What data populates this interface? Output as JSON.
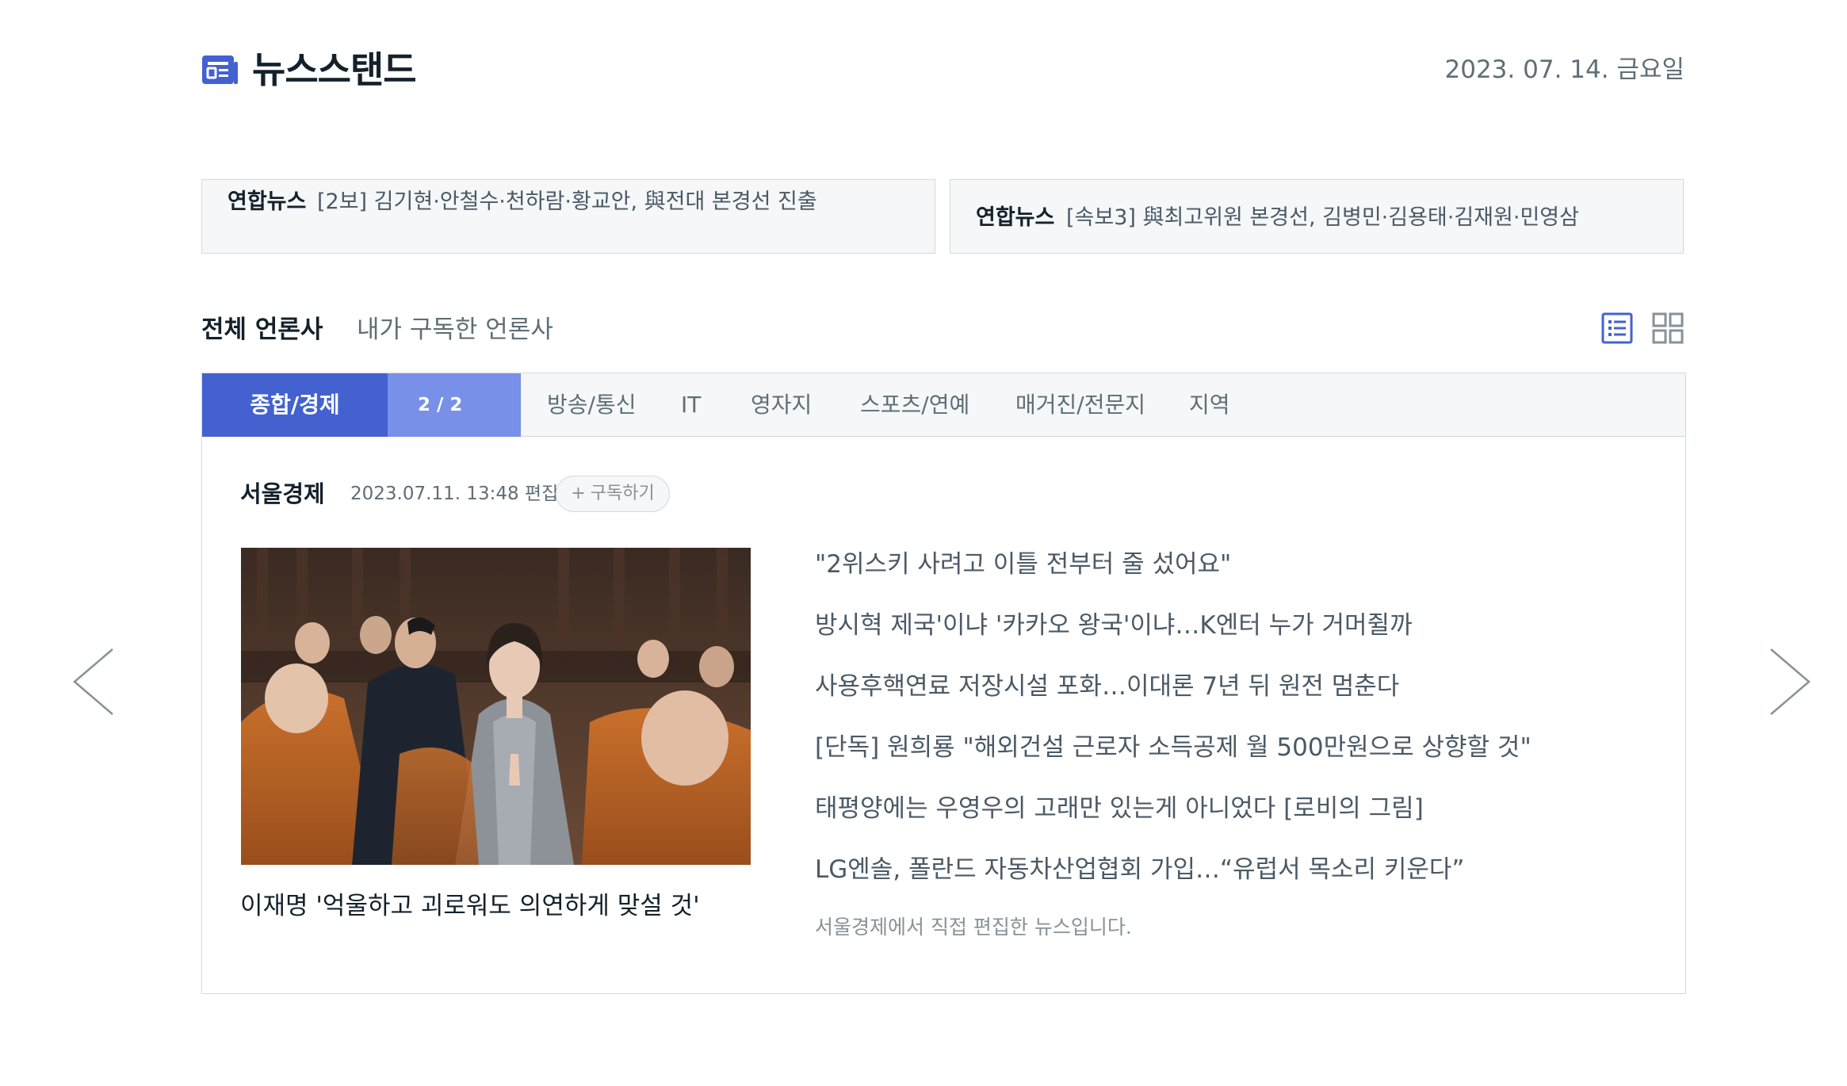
{
  "header": {
    "brand": "뉴스스탠드",
    "date": "2023. 07. 14. 금요일"
  },
  "headlines": [
    {
      "source": "연합뉴스",
      "title": "[2보] 김기현·안철수·천하람·황교안, 與전대 본경선 진출"
    },
    {
      "source": "연합뉴스",
      "title": "[속보3] 與최고위원 본경선, 김병민·김용태·김재원·민영삼"
    }
  ],
  "press_tabs": {
    "all": "전체 언론사",
    "mine": "내가 구독한 언론사"
  },
  "category_tabs": {
    "active": "종합/경제",
    "counter": "2 / 2",
    "items": [
      "방송/통신",
      "IT",
      "영자지",
      "스포츠/연예",
      "매거진/전문지",
      "지역"
    ]
  },
  "press": {
    "name": "서울경제",
    "edited": "2023.07.11. 13:48 편집",
    "subscribe": "구독하기",
    "subscribe_plus": "+"
  },
  "main_article": {
    "title": "이재명 '억울하고 괴로워도 의연하게 맞설 것'"
  },
  "news": [
    "\"2위스키 사려고 이틀 전부터 줄 섰어요\"",
    "방시혁 제국'이냐 '카카오 왕국'이냐…K엔터 누가 거머쥘까",
    "사용후핵연료 저장시설 포화…이대론 7년 뒤 원전 멈춘다",
    "[단독] 원희룡 \"해외건설 근로자 소득공제 월 500만원으로 상향할 것\"",
    "태평양에는 우영우의 고래만 있는게 아니었다 [로비의 그림]",
    "LG엔솔, 폴란드 자동차산업협회 가입…“유럽서 목소리 키운다”"
  ],
  "edit_note": "서울경제에서 직접 편집한 뉴스입니다.",
  "colors": {
    "accent": "#4362d0",
    "accent_light": "#7890e7"
  }
}
